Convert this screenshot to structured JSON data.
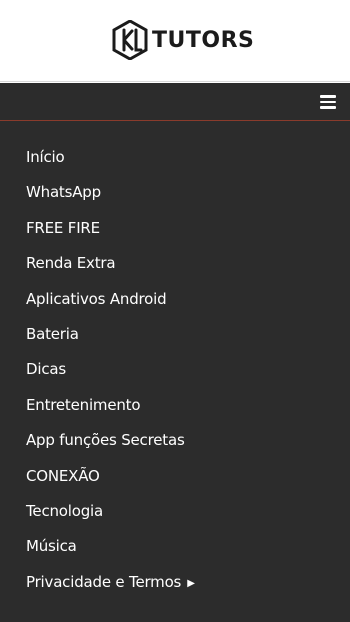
{
  "header": {
    "logo_text": "TUTORS",
    "logo_icon": "kl-monogram-logo"
  },
  "menu_bar": {
    "toggle_icon": "hamburger-icon"
  },
  "nav": {
    "items": [
      {
        "label": "Início"
      },
      {
        "label": "WhatsApp"
      },
      {
        "label": "FREE FIRE"
      },
      {
        "label": "Renda Extra"
      },
      {
        "label": "Aplicativos Android"
      },
      {
        "label": "Bateria"
      },
      {
        "label": "Dicas"
      },
      {
        "label": "Entretenimento"
      },
      {
        "label": "App funções Secretas"
      },
      {
        "label": "CONEXÃO"
      },
      {
        "label": "Tecnologia"
      },
      {
        "label": "Música"
      },
      {
        "label": "Privacidade e Termos",
        "submenu_icon": "caret-right-icon"
      }
    ]
  },
  "colors": {
    "menu_background": "#2c2c2c",
    "menu_divider": "#8a3b2c",
    "menu_text": "#ffffff",
    "header_background": "#ffffff"
  }
}
